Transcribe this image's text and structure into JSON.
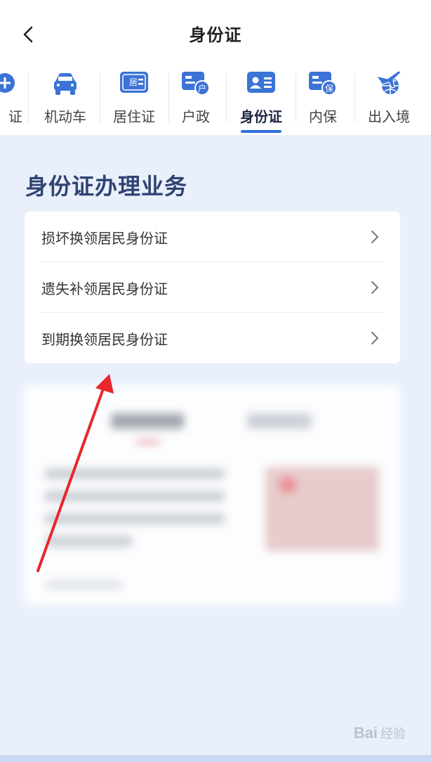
{
  "header": {
    "title": "身份证"
  },
  "tabs": [
    {
      "label": "证",
      "icon": "partial-circle-icon"
    },
    {
      "label": "机动车",
      "icon": "car-icon"
    },
    {
      "label": "居住证",
      "icon": "residence-card-icon",
      "badge": "居"
    },
    {
      "label": "户政",
      "icon": "household-icon",
      "badge": "户"
    },
    {
      "label": "身份证",
      "icon": "id-card-icon",
      "active": true
    },
    {
      "label": "内保",
      "icon": "insurance-icon",
      "badge": "保"
    },
    {
      "label": "出入境",
      "icon": "plane-globe-icon"
    }
  ],
  "section": {
    "title": "身份证办理业务",
    "items": [
      {
        "label": "损坏换领居民身份证"
      },
      {
        "label": "遗失补领居民身份证"
      },
      {
        "label": "到期换领居民身份证"
      }
    ]
  },
  "watermark": {
    "text": "Bai",
    "text_cn": "经验"
  },
  "colors": {
    "accent": "#2f6fdc",
    "icon_blue": "#3b73d6",
    "section_title": "#2f4372",
    "background": "#e9f0fb",
    "arrow": "#e8262b"
  }
}
